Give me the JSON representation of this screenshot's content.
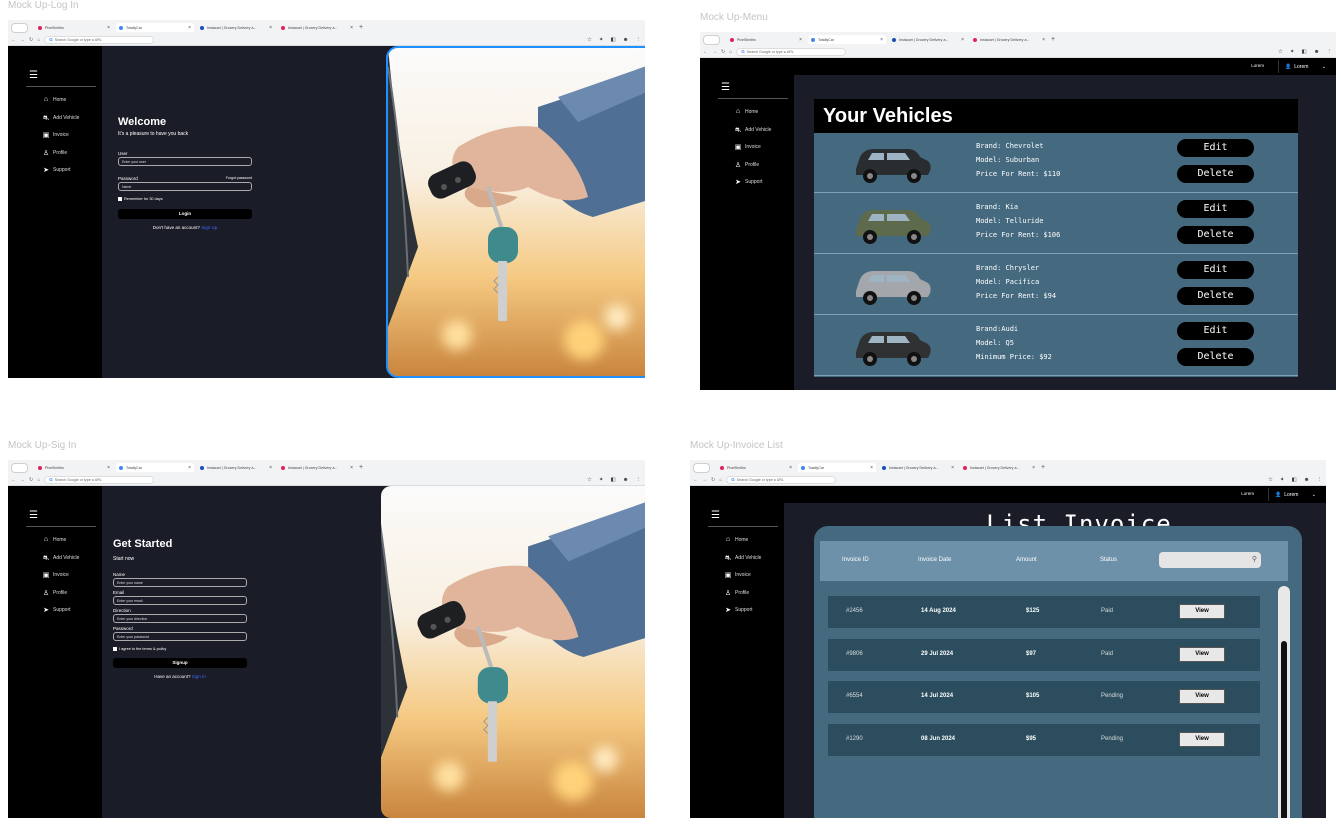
{
  "frames": {
    "login": "Mock Up-Log In",
    "menu": "Mock Up-Menu",
    "signin": "Mock Up-Sig In",
    "invoice": "Mock Up-Invoice List"
  },
  "browser": {
    "tabs": [
      "PixelSmiths",
      "TotallyCar",
      "Instacart | Grocery Delivery a...",
      "Instacart | Grocery Delivery a..."
    ],
    "new_tab": "+",
    "url_placeholder": "Search Google or type a URL",
    "tab_colors": [
      "#e0245e",
      "#4285f4",
      "#1a4fb5",
      "#e0245e"
    ]
  },
  "sidebar": {
    "items": [
      {
        "label": "Home",
        "icon": "home-icon"
      },
      {
        "label": "Add Vehicle",
        "icon": "car-icon"
      },
      {
        "label": "Invoice",
        "icon": "folder-icon"
      },
      {
        "label": "Profile",
        "icon": "user-icon"
      },
      {
        "label": "Support",
        "icon": "megaphone-icon"
      }
    ]
  },
  "login": {
    "title": "Welcome",
    "subtitle": "It's a pleasure to have you back",
    "user_label": "User",
    "user_placeholder": "Enter your user",
    "password_label": "Password",
    "forgot": "Forgot password",
    "password_placeholder": "Name",
    "remember": "Remember for 30 days",
    "button": "Login",
    "no_account": "Don't have an account?",
    "signup_link": "Sign Up"
  },
  "signup": {
    "title": "Get Started",
    "subtitle": "Start now",
    "name_label": "Name",
    "name_placeholder": "Enter your name",
    "email_label": "Email",
    "email_placeholder": "Enter your email",
    "direction_label": "Direction",
    "direction_placeholder": "Enter your direction",
    "password_label": "Password",
    "password_placeholder": "Enter your password",
    "agree": "I agree to the terms & policy",
    "button": "Signup",
    "have_account": "Have an account?",
    "signin_link": "Sign In"
  },
  "topbar": {
    "lorem": "Lorem",
    "user": "Lorem"
  },
  "vehicles": {
    "title": "Your Vehicles",
    "edit": "Edit",
    "delete": "Delete",
    "items": [
      {
        "brand": "Brand: Chevrolet",
        "model": "Model: Suburban",
        "price": "Price For Rent: $110",
        "color": "#2a2d30"
      },
      {
        "brand": "Brand: Kia",
        "model": "Model: Telluride",
        "price": "Price For Rent: $106",
        "color": "#5e6a4c"
      },
      {
        "brand": "Brand: Chrysler",
        "model": "Model: Pacifica",
        "price": "Price For Rent: $94",
        "color": "#a3a7ab"
      },
      {
        "brand": "Brand:Audi",
        "model": "Model: Q5",
        "price": "Minimum Price: $92",
        "color": "#2f3133"
      }
    ]
  },
  "invoices": {
    "title": "List Invoice",
    "headers": [
      "Invoice ID",
      "Invoice  Date",
      "Amount",
      "Status"
    ],
    "view": "View",
    "rows": [
      {
        "id": "#2456",
        "date": "14 Aug 2024",
        "amount": "$125",
        "status": "Paid"
      },
      {
        "id": "#9806",
        "date": "29 Jul 2024",
        "amount": "$97",
        "status": "Paid"
      },
      {
        "id": "#6554",
        "date": "14 Jul 2024",
        "amount": "$105",
        "status": "Pending"
      },
      {
        "id": "#1290",
        "date": "08 Jun 2024",
        "amount": "$95",
        "status": "Pending"
      }
    ]
  }
}
